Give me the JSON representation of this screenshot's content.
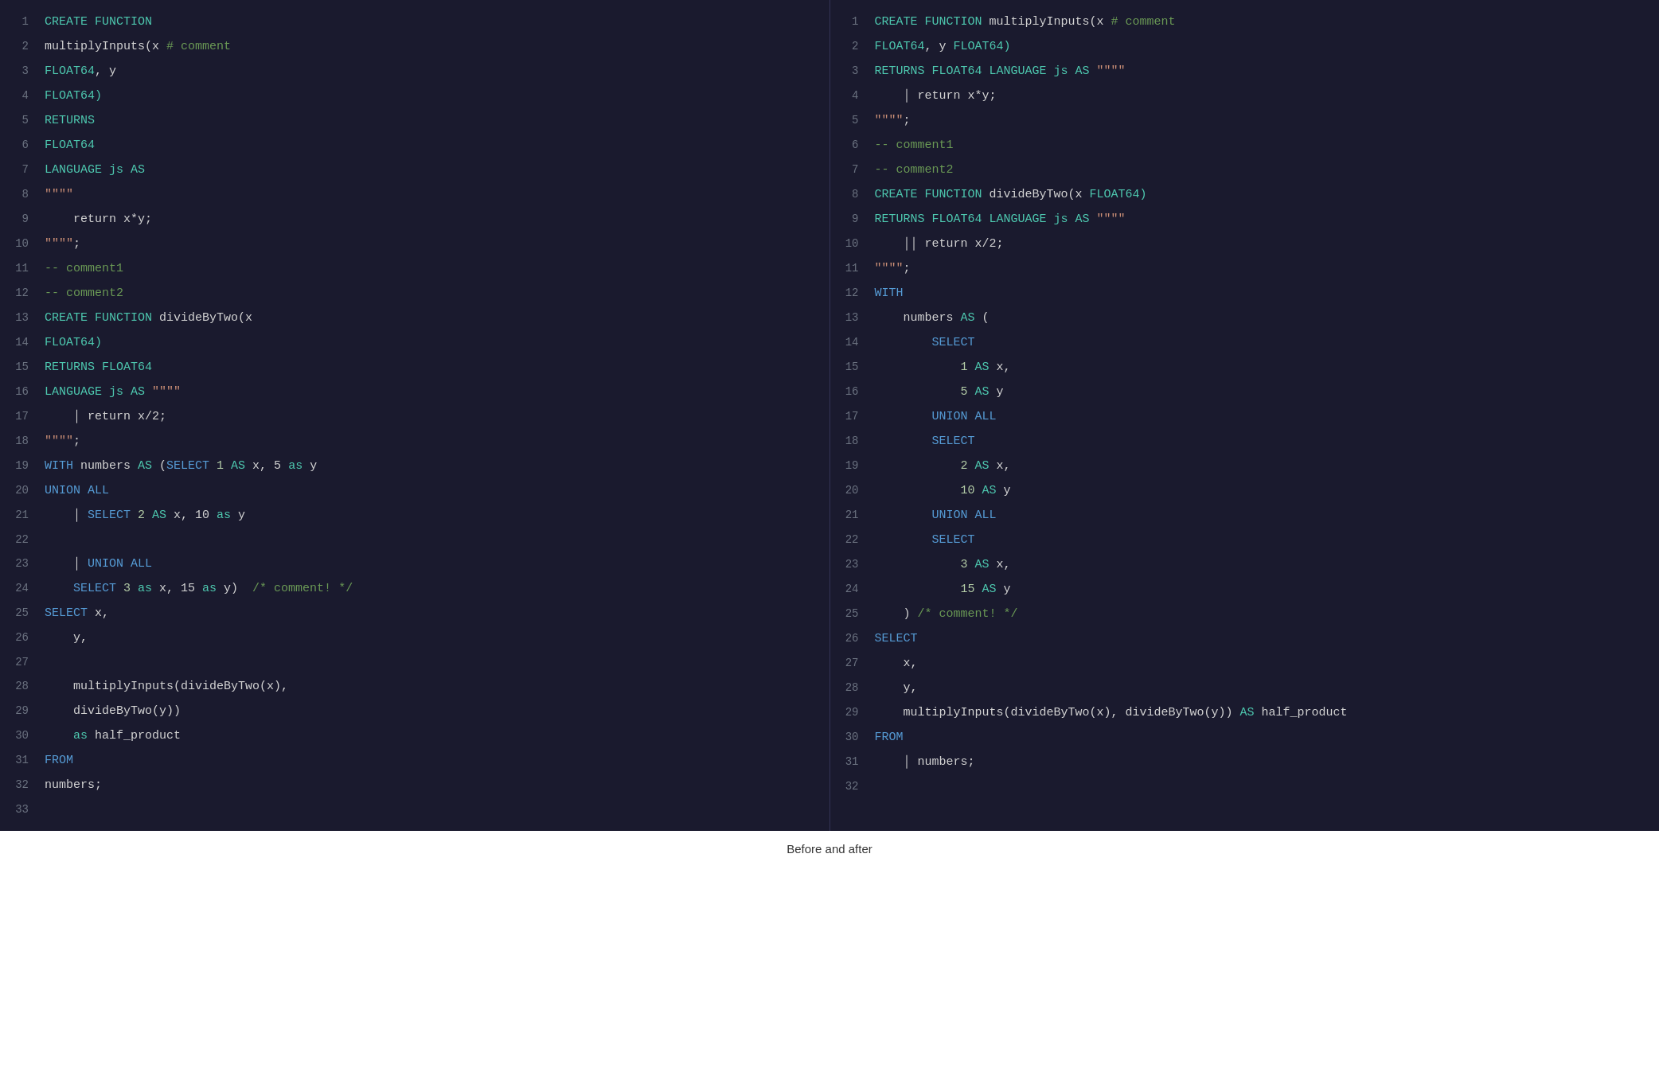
{
  "caption": "Before and after",
  "left_panel": {
    "lines": [
      {
        "num": 1,
        "tokens": [
          {
            "t": "CREATE FUNCTION",
            "c": "kw"
          }
        ]
      },
      {
        "num": 2,
        "tokens": [
          {
            "t": "multiplyInputs(x ",
            "c": "plain"
          },
          {
            "t": "# comment",
            "c": "comment"
          }
        ]
      },
      {
        "num": 3,
        "tokens": [
          {
            "t": "FLOAT64",
            "c": "type"
          },
          {
            "t": ", y",
            "c": "plain"
          }
        ]
      },
      {
        "num": 4,
        "tokens": [
          {
            "t": "FLOAT64)",
            "c": "type"
          }
        ]
      },
      {
        "num": 5,
        "tokens": [
          {
            "t": "RETURNS",
            "c": "kw"
          }
        ]
      },
      {
        "num": 6,
        "tokens": [
          {
            "t": "FLOAT64",
            "c": "type"
          }
        ]
      },
      {
        "num": 7,
        "tokens": [
          {
            "t": "LANGUAGE ",
            "c": "kw"
          },
          {
            "t": "js ",
            "c": "kw"
          },
          {
            "t": "AS",
            "c": "kw"
          }
        ]
      },
      {
        "num": 8,
        "tokens": [
          {
            "t": "\"\"\"\"",
            "c": "str"
          }
        ]
      },
      {
        "num": 9,
        "tokens": [
          {
            "t": "    return x*y;",
            "c": "plain"
          }
        ]
      },
      {
        "num": 10,
        "tokens": [
          {
            "t": "\"\"\"\"",
            "c": "str"
          },
          {
            "t": ";",
            "c": "plain"
          }
        ]
      },
      {
        "num": 11,
        "tokens": [
          {
            "t": "-- comment1",
            "c": "comment"
          }
        ]
      },
      {
        "num": 12,
        "tokens": [
          {
            "t": "-- comment2",
            "c": "comment"
          }
        ]
      },
      {
        "num": 13,
        "tokens": [
          {
            "t": "CREATE FUNCTION ",
            "c": "kw"
          },
          {
            "t": "divideByTwo(x",
            "c": "plain"
          }
        ]
      },
      {
        "num": 14,
        "tokens": [
          {
            "t": "FLOAT64)",
            "c": "type"
          }
        ]
      },
      {
        "num": 15,
        "tokens": [
          {
            "t": "RETURNS ",
            "c": "kw"
          },
          {
            "t": "FLOAT64",
            "c": "type"
          }
        ]
      },
      {
        "num": 16,
        "tokens": [
          {
            "t": "LANGUAGE ",
            "c": "kw"
          },
          {
            "t": "js ",
            "c": "kw"
          },
          {
            "t": "AS ",
            "c": "kw"
          },
          {
            "t": "\"\"\"\"",
            "c": "str"
          }
        ]
      },
      {
        "num": 17,
        "tokens": [
          {
            "t": "    │ return x/2;",
            "c": "plain"
          }
        ]
      },
      {
        "num": 18,
        "tokens": [
          {
            "t": "\"\"\"\"",
            "c": "str"
          },
          {
            "t": ";",
            "c": "plain"
          }
        ]
      },
      {
        "num": 19,
        "tokens": [
          {
            "t": "WITH ",
            "c": "kw2"
          },
          {
            "t": "numbers ",
            "c": "plain"
          },
          {
            "t": "AS ",
            "c": "kw-as"
          },
          {
            "t": "(",
            "c": "plain"
          },
          {
            "t": "SELECT ",
            "c": "kw2"
          },
          {
            "t": "1 ",
            "c": "num"
          },
          {
            "t": "AS ",
            "c": "kw-as"
          },
          {
            "t": "x, 5 ",
            "c": "plain"
          },
          {
            "t": "as ",
            "c": "kw-as"
          },
          {
            "t": "y",
            "c": "plain"
          }
        ]
      },
      {
        "num": 20,
        "tokens": [
          {
            "t": "UNION ALL",
            "c": "kw2"
          }
        ]
      },
      {
        "num": 21,
        "tokens": [
          {
            "t": "    │ ",
            "c": "plain"
          },
          {
            "t": "SELECT ",
            "c": "kw2"
          },
          {
            "t": "2 ",
            "c": "num"
          },
          {
            "t": "AS ",
            "c": "kw-as"
          },
          {
            "t": "x, 10 ",
            "c": "plain"
          },
          {
            "t": "as ",
            "c": "kw-as"
          },
          {
            "t": "y",
            "c": "plain"
          }
        ]
      },
      {
        "num": 22,
        "tokens": []
      },
      {
        "num": 23,
        "tokens": [
          {
            "t": "    │ ",
            "c": "plain"
          },
          {
            "t": "UNION ALL",
            "c": "kw2"
          }
        ]
      },
      {
        "num": 24,
        "tokens": [
          {
            "t": "    ",
            "c": "plain"
          },
          {
            "t": "SELECT ",
            "c": "kw2"
          },
          {
            "t": "3 ",
            "c": "num"
          },
          {
            "t": "as ",
            "c": "kw-as"
          },
          {
            "t": "x, 15 ",
            "c": "plain"
          },
          {
            "t": "as ",
            "c": "kw-as"
          },
          {
            "t": "y)  ",
            "c": "plain"
          },
          {
            "t": "/* comment! */",
            "c": "comment"
          }
        ]
      },
      {
        "num": 25,
        "tokens": [
          {
            "t": "SELECT ",
            "c": "kw2"
          },
          {
            "t": "x,",
            "c": "plain"
          }
        ]
      },
      {
        "num": 26,
        "tokens": [
          {
            "t": "    y,",
            "c": "plain"
          }
        ]
      },
      {
        "num": 27,
        "tokens": []
      },
      {
        "num": 28,
        "tokens": [
          {
            "t": "    multiplyInputs(divideByTwo(x),",
            "c": "plain"
          }
        ]
      },
      {
        "num": 29,
        "tokens": [
          {
            "t": "    divideByTwo(y))",
            "c": "plain"
          }
        ]
      },
      {
        "num": 30,
        "tokens": [
          {
            "t": "    ",
            "c": "plain"
          },
          {
            "t": "as ",
            "c": "kw-as"
          },
          {
            "t": "half_product",
            "c": "plain"
          }
        ]
      },
      {
        "num": 31,
        "tokens": [
          {
            "t": "FROM",
            "c": "kw2"
          }
        ]
      },
      {
        "num": 32,
        "tokens": [
          {
            "t": "numbers;",
            "c": "plain"
          }
        ]
      },
      {
        "num": 33,
        "tokens": []
      }
    ]
  },
  "right_panel": {
    "lines": [
      {
        "num": 1,
        "tokens": [
          {
            "t": "CREATE FUNCTION ",
            "c": "kw"
          },
          {
            "t": "multiplyInputs(x ",
            "c": "plain"
          },
          {
            "t": "# comment",
            "c": "comment"
          }
        ]
      },
      {
        "num": 2,
        "tokens": [
          {
            "t": "FLOAT64",
            "c": "type"
          },
          {
            "t": ", y ",
            "c": "plain"
          },
          {
            "t": "FLOAT64)",
            "c": "type"
          }
        ]
      },
      {
        "num": 3,
        "tokens": [
          {
            "t": "RETURNS ",
            "c": "kw"
          },
          {
            "t": "FLOAT64 ",
            "c": "type"
          },
          {
            "t": "LANGUAGE ",
            "c": "kw"
          },
          {
            "t": "js ",
            "c": "kw"
          },
          {
            "t": "AS ",
            "c": "kw-as"
          },
          {
            "t": "\"\"\"\"",
            "c": "str"
          }
        ]
      },
      {
        "num": 4,
        "tokens": [
          {
            "t": "    │ return x*y;",
            "c": "plain"
          }
        ]
      },
      {
        "num": 5,
        "tokens": [
          {
            "t": "\"\"\"\"",
            "c": "str"
          },
          {
            "t": ";",
            "c": "plain"
          }
        ]
      },
      {
        "num": 6,
        "tokens": [
          {
            "t": "-- comment1",
            "c": "comment"
          }
        ]
      },
      {
        "num": 7,
        "tokens": [
          {
            "t": "-- comment2",
            "c": "comment"
          }
        ]
      },
      {
        "num": 8,
        "tokens": [
          {
            "t": "CREATE FUNCTION ",
            "c": "kw"
          },
          {
            "t": "divideByTwo(x ",
            "c": "plain"
          },
          {
            "t": "FLOAT64)",
            "c": "type"
          }
        ]
      },
      {
        "num": 9,
        "tokens": [
          {
            "t": "RETURNS ",
            "c": "kw"
          },
          {
            "t": "FLOAT64 ",
            "c": "type"
          },
          {
            "t": "LANGUAGE ",
            "c": "kw"
          },
          {
            "t": "js ",
            "c": "kw"
          },
          {
            "t": "AS ",
            "c": "kw-as"
          },
          {
            "t": "\"\"\"\"",
            "c": "str"
          }
        ]
      },
      {
        "num": 10,
        "tokens": [
          {
            "t": "    ││ return x/2;",
            "c": "plain"
          }
        ]
      },
      {
        "num": 11,
        "tokens": [
          {
            "t": "\"\"\"\"",
            "c": "str"
          },
          {
            "t": ";",
            "c": "plain"
          }
        ]
      },
      {
        "num": 12,
        "tokens": [
          {
            "t": "WITH",
            "c": "kw2"
          }
        ]
      },
      {
        "num": 13,
        "tokens": [
          {
            "t": "    numbers ",
            "c": "plain"
          },
          {
            "t": "AS",
            "c": "kw-as"
          },
          {
            "t": " (",
            "c": "plain"
          }
        ]
      },
      {
        "num": 14,
        "tokens": [
          {
            "t": "        ",
            "c": "plain"
          },
          {
            "t": "SELECT",
            "c": "kw2"
          }
        ]
      },
      {
        "num": 15,
        "tokens": [
          {
            "t": "            ",
            "c": "plain"
          },
          {
            "t": "1 ",
            "c": "num"
          },
          {
            "t": "AS ",
            "c": "kw-as"
          },
          {
            "t": "x,",
            "c": "plain"
          }
        ]
      },
      {
        "num": 16,
        "tokens": [
          {
            "t": "            ",
            "c": "plain"
          },
          {
            "t": "5 ",
            "c": "num"
          },
          {
            "t": "AS ",
            "c": "kw-as"
          },
          {
            "t": "y",
            "c": "plain"
          }
        ]
      },
      {
        "num": 17,
        "tokens": [
          {
            "t": "        ",
            "c": "plain"
          },
          {
            "t": "UNION ALL",
            "c": "kw2"
          }
        ]
      },
      {
        "num": 18,
        "tokens": [
          {
            "t": "        ",
            "c": "plain"
          },
          {
            "t": "SELECT",
            "c": "kw2"
          }
        ]
      },
      {
        "num": 19,
        "tokens": [
          {
            "t": "            ",
            "c": "plain"
          },
          {
            "t": "2 ",
            "c": "num"
          },
          {
            "t": "AS ",
            "c": "kw-as"
          },
          {
            "t": "x,",
            "c": "plain"
          }
        ]
      },
      {
        "num": 20,
        "tokens": [
          {
            "t": "            ",
            "c": "plain"
          },
          {
            "t": "10 ",
            "c": "num"
          },
          {
            "t": "AS ",
            "c": "kw-as"
          },
          {
            "t": "y",
            "c": "plain"
          }
        ]
      },
      {
        "num": 21,
        "tokens": [
          {
            "t": "        ",
            "c": "plain"
          },
          {
            "t": "UNION ALL",
            "c": "kw2"
          }
        ]
      },
      {
        "num": 22,
        "tokens": [
          {
            "t": "        ",
            "c": "plain"
          },
          {
            "t": "SELECT",
            "c": "kw2"
          }
        ]
      },
      {
        "num": 23,
        "tokens": [
          {
            "t": "            ",
            "c": "plain"
          },
          {
            "t": "3 ",
            "c": "num"
          },
          {
            "t": "AS ",
            "c": "kw-as"
          },
          {
            "t": "x,",
            "c": "plain"
          }
        ]
      },
      {
        "num": 24,
        "tokens": [
          {
            "t": "            ",
            "c": "plain"
          },
          {
            "t": "15 ",
            "c": "num"
          },
          {
            "t": "AS ",
            "c": "kw-as"
          },
          {
            "t": "y",
            "c": "plain"
          }
        ]
      },
      {
        "num": 25,
        "tokens": [
          {
            "t": "    ) ",
            "c": "plain"
          },
          {
            "t": "/* comment! */",
            "c": "comment"
          }
        ]
      },
      {
        "num": 26,
        "tokens": [
          {
            "t": "SELECT",
            "c": "kw2"
          }
        ]
      },
      {
        "num": 27,
        "tokens": [
          {
            "t": "    x,",
            "c": "plain"
          }
        ]
      },
      {
        "num": 28,
        "tokens": [
          {
            "t": "    y,",
            "c": "plain"
          }
        ]
      },
      {
        "num": 29,
        "tokens": [
          {
            "t": "    multiplyInputs(divideByTwo(x), divideByTwo(y)) ",
            "c": "plain"
          },
          {
            "t": "AS ",
            "c": "kw-as"
          },
          {
            "t": "half_product",
            "c": "plain"
          }
        ]
      },
      {
        "num": 30,
        "tokens": [
          {
            "t": "FROM",
            "c": "kw2"
          }
        ]
      },
      {
        "num": 31,
        "tokens": [
          {
            "t": "    │ numbers;",
            "c": "plain"
          }
        ]
      },
      {
        "num": 32,
        "tokens": []
      }
    ]
  }
}
